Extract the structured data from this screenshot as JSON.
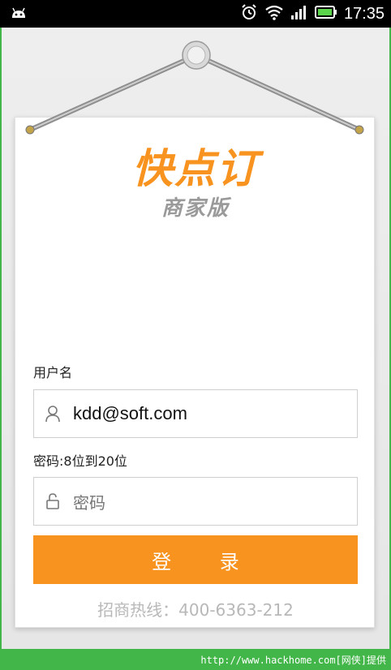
{
  "status_bar": {
    "time": "17:35",
    "icons": [
      "android-icon",
      "alarm-icon",
      "wifi-icon",
      "signal-icon",
      "battery-icon"
    ]
  },
  "brand": {
    "title": "快点订",
    "subtitle": "商家版",
    "accent_color": "#f7931e"
  },
  "form": {
    "username_label": "用户名",
    "username_value": "kdd@soft.com",
    "password_label": "密码:8位到20位",
    "password_placeholder": "密码",
    "login_button": "登 录"
  },
  "hotline": "招商热线：400-6363-212",
  "watermark": "http://www.hackhome.com[网侠]提供"
}
